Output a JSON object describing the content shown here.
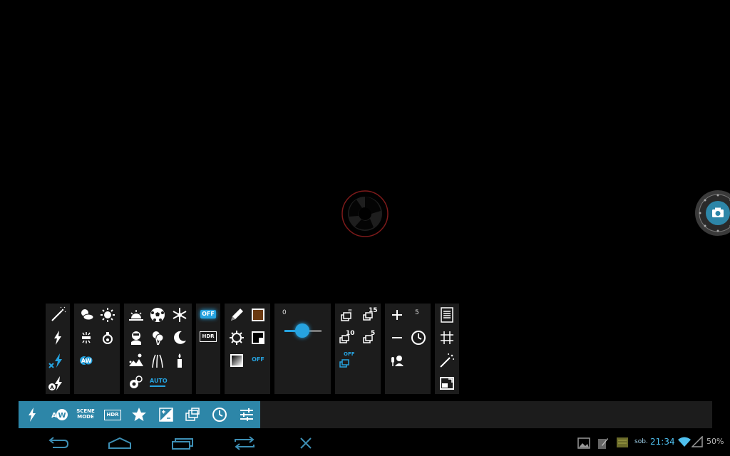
{
  "viewfinder": {
    "focus_indicator": "focus-ring-icon"
  },
  "shutter": {
    "icon": "camera-icon"
  },
  "panels": {
    "flash": {
      "items": [
        "flash-torch-icon",
        "flash-on-icon",
        "flash-off-icon",
        "flash-auto-icon"
      ]
    },
    "white_balance": {
      "items": [
        "cloudy-icon",
        "daylight-icon",
        "fluorescent-icon",
        "incandescent-icon",
        "auto-wb-icon"
      ],
      "auto_label": "A W"
    },
    "scene_mode": {
      "items": [
        "sunset-icon",
        "sports-icon",
        "snow-icon",
        "portrait-icon",
        "party-icon",
        "night-icon",
        "landscape-icon",
        "fireworks-icon",
        "candle-icon",
        "action-icon"
      ],
      "auto_label": "AUTO"
    },
    "hdr": {
      "off_label": "OFF",
      "hdr_label": "HDR"
    },
    "effects": {
      "items": [
        "sketch-icon",
        "sepia-icon",
        "solarize-icon",
        "posterize-icon",
        "mono-icon"
      ],
      "off_label": "OFF"
    },
    "exposure": {
      "value_label": "0",
      "slider_level": 0.5
    },
    "burst": {
      "labels": {
        "n15": "15",
        "n10": "10",
        "n5": "5",
        "off": "OFF"
      }
    },
    "timer": {
      "value_label": "5"
    },
    "extras": {
      "items": [
        "document-icon",
        "grid-icon",
        "magic-wand-icon",
        "picture-in-picture-icon"
      ]
    }
  },
  "toolbar": {
    "scene_label": "SCENE\nMODE",
    "scene_line1": "SCENE",
    "scene_line2": "MODE",
    "hdr_label": "HDR",
    "aw_label": "W",
    "aw_prefix": "A"
  },
  "status": {
    "day": "sob.",
    "time": "21:34",
    "battery": "50%"
  },
  "colors": {
    "accent": "#2d86a8",
    "highlight": "#26a3e0",
    "panel_bg": "#1c1c1c",
    "focus_ring": "#8b1a1a"
  }
}
